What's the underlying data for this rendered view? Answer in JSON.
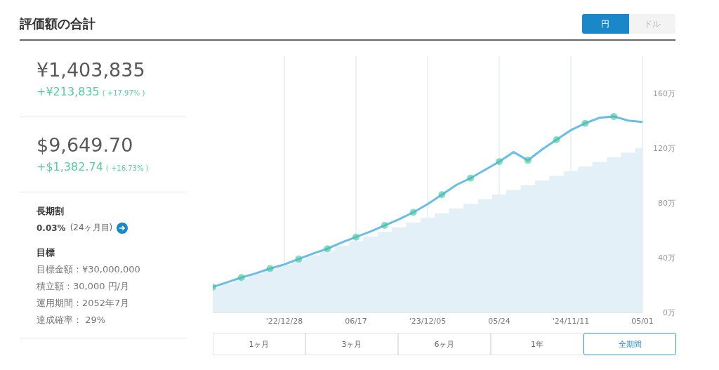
{
  "header": {
    "title": "評価額の合計",
    "currency_toggle": [
      {
        "label": "円",
        "selected": true
      },
      {
        "label": "ドル",
        "selected": false
      }
    ]
  },
  "summary": [
    {
      "total": "¥1,403,835",
      "gain": "+¥213,835",
      "gain_percent": "( +17.97% )"
    },
    {
      "total": "$9,649.70",
      "gain": "+$1,382.74",
      "gain_percent": "( +16.73% )"
    }
  ],
  "long_term_discount": {
    "title": "長期割",
    "rate": "0.03%",
    "months": "(24ヶ月目)"
  },
  "goal": {
    "title": "目標",
    "lines": [
      "目標金額：¥30,000,000",
      "積立額：30,000 円/月",
      "運用期間：2052年7月",
      "達成確率： 29%"
    ]
  },
  "chart": {
    "chart_data": {
      "type": "line",
      "grid": true,
      "ylim": [
        0,
        187
      ],
      "categories": [
        null,
        null,
        null,
        null,
        null,
        "'22/12/28",
        null,
        null,
        null,
        null,
        "06/17",
        null,
        null,
        null,
        null,
        "'23/12/05",
        null,
        null,
        null,
        null,
        "05/24",
        null,
        null,
        null,
        null,
        "'24/11/11",
        null,
        null,
        null,
        null,
        "05/01"
      ],
      "series": [
        {
          "type": "area",
          "color": "#e3f0f8",
          "values": [
            18,
            21.4,
            24.8,
            28.2,
            31.6,
            35,
            38.4,
            41.8,
            45.2,
            48.6,
            52,
            55.4,
            58.8,
            62.2,
            65.6,
            69,
            72.4,
            75.8,
            79.2,
            82.6,
            86,
            89.4,
            92.8,
            96.2,
            99.6,
            103,
            106.4,
            109.8,
            113.2,
            116.6,
            120
          ]
        },
        {
          "type": "line",
          "color": "#6bbde8",
          "values": [
            18.5,
            22,
            25.5,
            28.5,
            32,
            35,
            39,
            43,
            46.5,
            51,
            55,
            59,
            63.5,
            68,
            73,
            79,
            86,
            93,
            98,
            104,
            110,
            117,
            111,
            119,
            126,
            133,
            138,
            142,
            143,
            140,
            139
          ]
        }
      ],
      "yticks": [
        {
          "value": 0,
          "label": "0万"
        },
        {
          "value": 40,
          "label": "40万"
        },
        {
          "value": 80,
          "label": "80万"
        },
        {
          "value": 120,
          "label": "120万"
        },
        {
          "value": 160,
          "label": "160万"
        }
      ]
    }
  },
  "range_tabs": [
    {
      "label": "1ヶ月",
      "selected": false
    },
    {
      "label": "3ヶ月",
      "selected": false
    },
    {
      "label": "6ヶ月",
      "selected": false
    },
    {
      "label": "1年",
      "selected": false
    },
    {
      "label": "全期間",
      "selected": true
    }
  ]
}
